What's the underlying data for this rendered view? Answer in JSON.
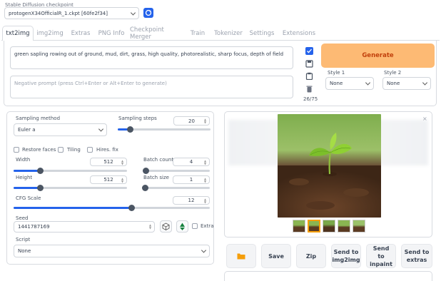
{
  "checkpoint": {
    "label": "Stable Diffusion checkpoint",
    "value": "protogenX34OfficialR_1.ckpt [60fe2f34]"
  },
  "tabs": [
    "txt2img",
    "img2img",
    "Extras",
    "PNG Info",
    "Checkpoint Merger",
    "Train",
    "Tokenizer",
    "Settings",
    "Extensions"
  ],
  "prompt": {
    "value": "green sapling rowing out of ground, mud, dirt, grass, high quality, photorealistic, sharp focus, depth of field"
  },
  "negative_prompt": {
    "placeholder": "Negative prompt (press Ctrl+Enter or Alt+Enter to generate)"
  },
  "token_count": "26/75",
  "generate_label": "Generate",
  "style1": {
    "label": "Style 1",
    "value": "None"
  },
  "style2": {
    "label": "Style 2",
    "value": "None"
  },
  "sampling_method": {
    "label": "Sampling method",
    "value": "Euler a"
  },
  "sampling_steps": {
    "label": "Sampling steps",
    "value": "20",
    "fraction": 0.13
  },
  "options": {
    "restore_faces": "Restore faces",
    "tiling": "Tiling",
    "hires_fix": "Hires. fix"
  },
  "width": {
    "label": "Width",
    "value": "512",
    "fraction": 0.23
  },
  "height": {
    "label": "Height",
    "value": "512",
    "fraction": 0.23
  },
  "batch_count": {
    "label": "Batch count",
    "value": "4",
    "fraction": 0.03
  },
  "batch_size": {
    "label": "Batch size",
    "value": "1",
    "fraction": 0.0
  },
  "cfg_scale": {
    "label": "CFG Scale",
    "value": "12",
    "fraction": 0.6
  },
  "seed": {
    "label": "Seed",
    "value": "1441787169",
    "extra_label": "Extra"
  },
  "script": {
    "label": "Script",
    "value": "None"
  },
  "output_buttons": {
    "folder": "folder-icon",
    "save": "Save",
    "zip": "Zip",
    "send_img2img": "Send to img2img",
    "send_inpaint": "Send to inpaint",
    "send_extras": "Send to extras"
  },
  "accent_color": "#fdba74",
  "slider_color": "#2563eb"
}
